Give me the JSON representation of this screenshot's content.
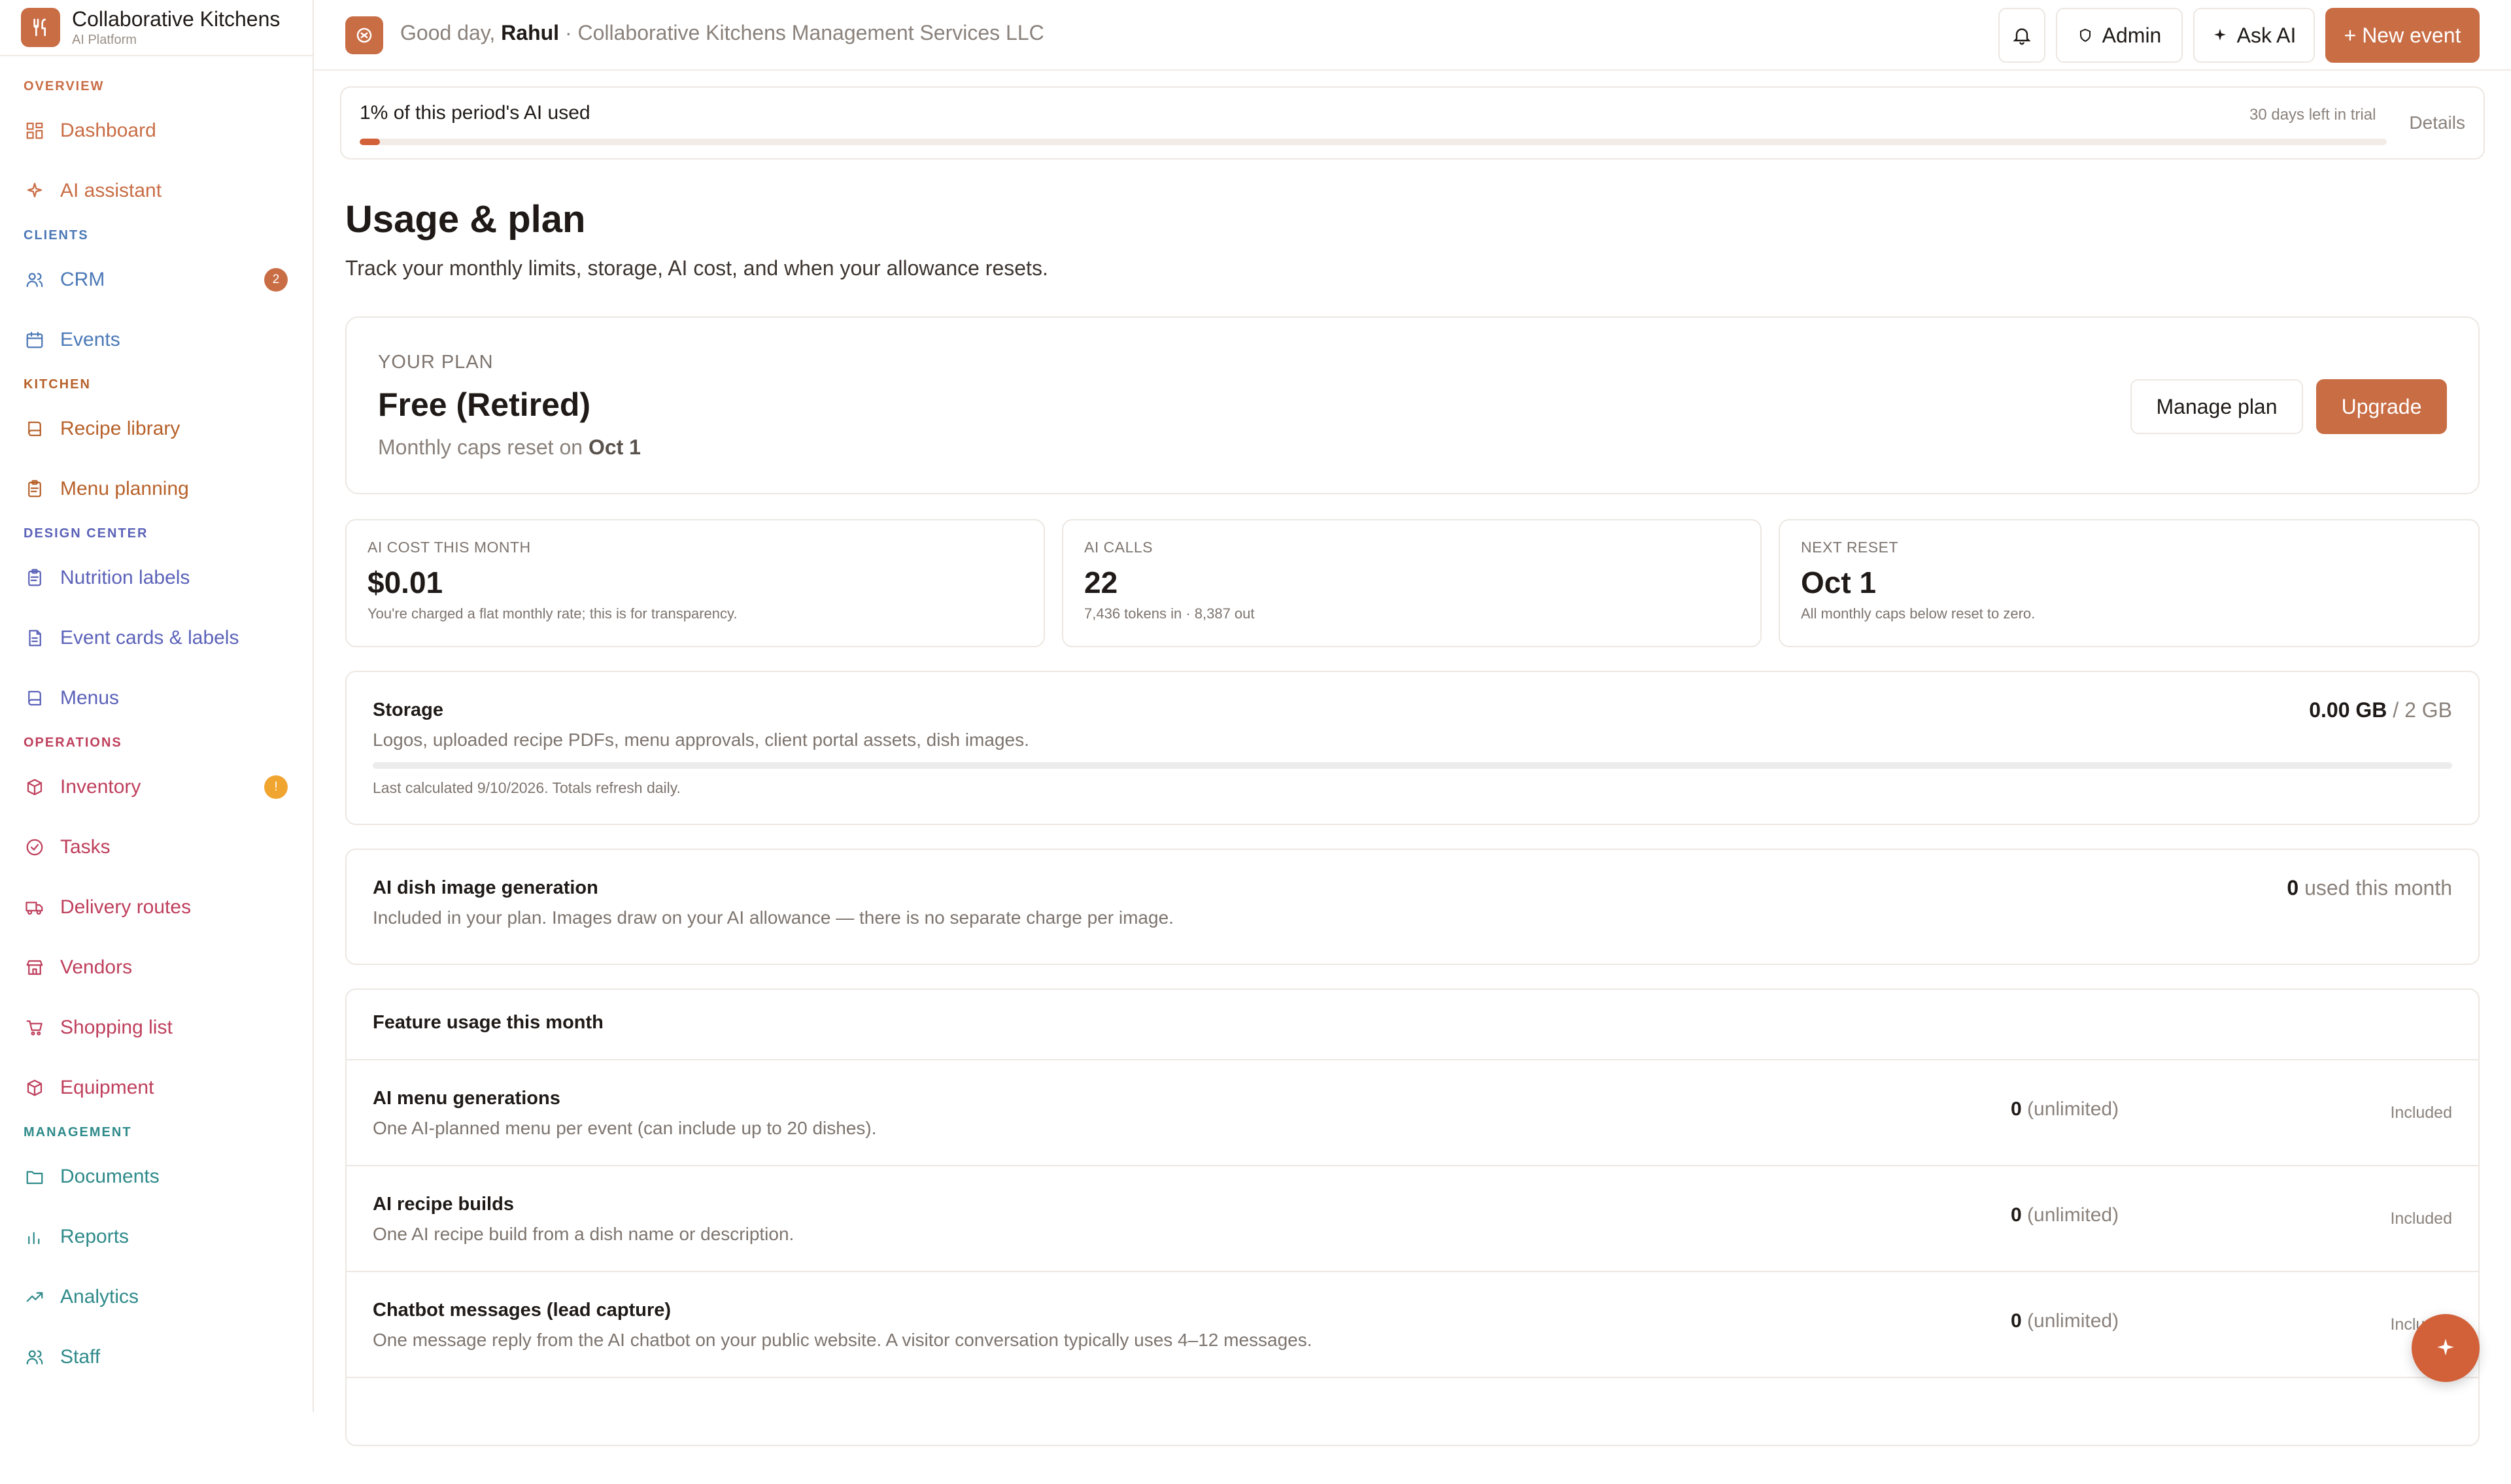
{
  "brand": {
    "name": "Collaborative Kitchens",
    "subtitle": "AI Platform",
    "accent": "#c96d45"
  },
  "sidebar": {
    "sections": [
      {
        "title": "OVERVIEW",
        "color": "#c96d45",
        "items": [
          {
            "label": "Dashboard",
            "icon": "dashboard-icon"
          },
          {
            "label": "AI assistant",
            "icon": "sparkle-icon"
          }
        ]
      },
      {
        "title": "CLIENTS",
        "color": "#4b78b6",
        "items": [
          {
            "label": "CRM",
            "icon": "users-icon",
            "badge": "2",
            "badge_color": "#c96d45"
          },
          {
            "label": "Events",
            "icon": "calendar-icon"
          }
        ]
      },
      {
        "title": "KITCHEN",
        "color": "#b7612a",
        "items": [
          {
            "label": "Recipe library",
            "icon": "book-icon"
          },
          {
            "label": "Menu planning",
            "icon": "clipboard-icon"
          }
        ]
      },
      {
        "title": "DESIGN CENTER",
        "color": "#5b62b8",
        "items": [
          {
            "label": "Nutrition labels",
            "icon": "clipboard-icon"
          },
          {
            "label": "Event cards & labels",
            "icon": "file-icon"
          },
          {
            "label": "Menus",
            "icon": "book-icon"
          }
        ]
      },
      {
        "title": "OPERATIONS",
        "color": "#bf3f5c",
        "items": [
          {
            "label": "Inventory",
            "icon": "box-icon",
            "badge": "!",
            "badge_color": "#f0a531"
          },
          {
            "label": "Tasks",
            "icon": "check-circle-icon"
          },
          {
            "label": "Delivery routes",
            "icon": "truck-icon"
          },
          {
            "label": "Vendors",
            "icon": "store-icon"
          },
          {
            "label": "Shopping list",
            "icon": "cart-icon"
          },
          {
            "label": "Equipment",
            "icon": "box-icon"
          }
        ]
      },
      {
        "title": "MANAGEMENT",
        "color": "#2f8a8a",
        "items": [
          {
            "label": "Documents",
            "icon": "folder-icon"
          },
          {
            "label": "Reports",
            "icon": "bar-chart-icon"
          },
          {
            "label": "Analytics",
            "icon": "trend-icon"
          },
          {
            "label": "Staff",
            "icon": "users-icon"
          }
        ]
      }
    ]
  },
  "topbar": {
    "greeting_prefix": "Good day,",
    "user_name": "Rahul",
    "org": "· Collaborative Kitchens Management Services LLC",
    "admin_label": "Admin",
    "ask_label": "Ask AI",
    "new_event_label": "+ New event"
  },
  "usage_banner": {
    "label": "1% of this period's AI used",
    "percent": 1,
    "trial_text": "30 days left in trial",
    "details_label": "Details"
  },
  "page": {
    "title": "Usage & plan",
    "subtitle": "Track your monthly limits, storage, AI cost, and when your allowance resets."
  },
  "plan": {
    "label": "YOUR PLAN",
    "name": "Free (Retired)",
    "reset_prefix": "Monthly caps reset on",
    "reset_date": "Oct 1",
    "manage_label": "Manage plan",
    "upgrade_label": "Upgrade"
  },
  "stats": [
    {
      "label": "AI COST THIS MONTH",
      "value": "$0.01",
      "sub": "You're charged a flat monthly rate; this is for transparency."
    },
    {
      "label": "AI CALLS",
      "value": "22",
      "sub": "7,436 tokens in · 8,387 out"
    },
    {
      "label": "NEXT RESET",
      "value": "Oct 1",
      "sub": "All monthly caps below reset to zero."
    }
  ],
  "storage": {
    "title": "Storage",
    "desc": "Logos, uploaded recipe PDFs, menu approvals, client portal assets, dish images.",
    "used": "0.00 GB",
    "total": "/ 2 GB",
    "used_fraction": 0,
    "note": "Last calculated 9/10/2026. Totals refresh daily."
  },
  "image_gen": {
    "title": "AI dish image generation",
    "desc": "Included in your plan. Images draw on your AI allowance — there is no separate charge per image.",
    "count": "0",
    "count_suffix": "used this month"
  },
  "features": {
    "title": "Feature usage this month",
    "rows": [
      {
        "title": "AI menu generations",
        "desc": "One AI-planned menu per event (can include up to 20 dishes).",
        "count": "0",
        "limit": "(unlimited)",
        "status": "Included"
      },
      {
        "title": "AI recipe builds",
        "desc": "One AI recipe build from a dish name or description.",
        "count": "0",
        "limit": "(unlimited)",
        "status": "Included"
      },
      {
        "title": "Chatbot messages (lead capture)",
        "desc": "One message reply from the AI chatbot on your public website. A visitor conversation typically uses 4–12 messages.",
        "count": "0",
        "limit": "(unlimited)",
        "status": "Included"
      }
    ]
  }
}
